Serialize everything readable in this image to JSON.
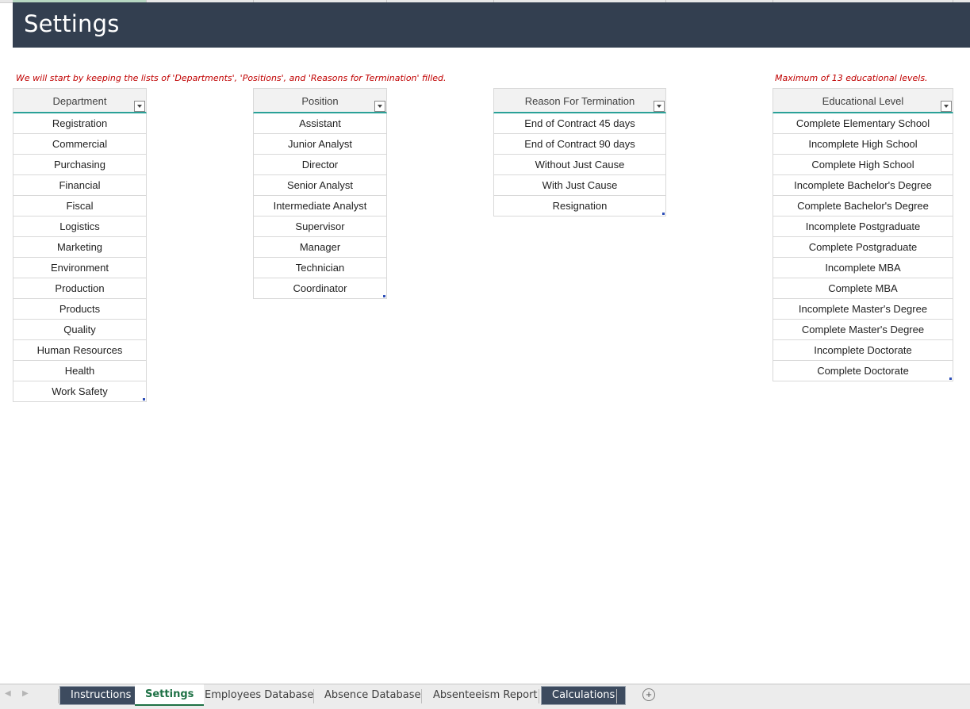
{
  "header": {
    "title": "Settings"
  },
  "notes": {
    "left": "We will start by keeping the lists of 'Departments', 'Positions', and 'Reasons for Termination' filled.",
    "right": "Maximum of 13 educational levels."
  },
  "tables": {
    "department": {
      "header": "Department",
      "rows": [
        "Registration",
        "Commercial",
        "Purchasing",
        "Financial",
        "Fiscal",
        "Logistics",
        "Marketing",
        "Environment",
        "Production",
        "Products",
        "Quality",
        "Human Resources",
        "Health",
        "Work Safety"
      ]
    },
    "position": {
      "header": "Position",
      "rows": [
        "Assistant",
        "Junior Analyst",
        "Director",
        "Senior Analyst",
        "Intermediate Analyst",
        "Supervisor",
        "Manager",
        "Technician",
        "Coordinator"
      ]
    },
    "termination": {
      "header": "Reason For Termination",
      "rows": [
        "End of Contract 45 days",
        "End of Contract 90 days",
        "Without Just Cause",
        "With Just Cause",
        "Resignation"
      ]
    },
    "education": {
      "header": "Educational Level",
      "rows": [
        "Complete Elementary School",
        "Incomplete High School",
        "Complete High School",
        "Incomplete Bachelor's Degree",
        "Complete Bachelor's Degree",
        "Incomplete Postgraduate",
        "Complete Postgraduate",
        "Incomplete MBA",
        "Complete MBA",
        "Incomplete Master's Degree",
        "Complete Master's Degree",
        "Incomplete Doctorate",
        "Complete Doctorate"
      ]
    }
  },
  "sheet_tabs": [
    {
      "label": "Instructions",
      "style": "dark"
    },
    {
      "label": "Settings",
      "style": "active"
    },
    {
      "label": "Employees Database",
      "style": "normal"
    },
    {
      "label": "Absence Database",
      "style": "normal"
    },
    {
      "label": "Absenteeism Report",
      "style": "normal"
    },
    {
      "label": "Calculations",
      "style": "dark"
    }
  ],
  "add_sheet_icon": "+",
  "colors": {
    "header_bg": "#333f50",
    "accent_teal": "#2aa198",
    "note_red": "#c00000",
    "active_tab": "#1e7145"
  }
}
